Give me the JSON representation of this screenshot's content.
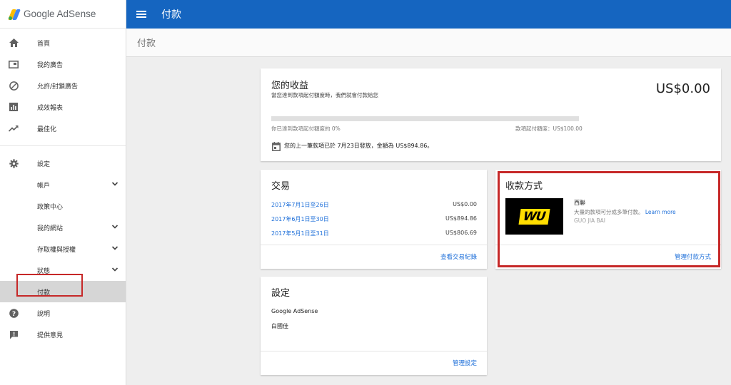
{
  "app": {
    "logo_text": "Google AdSense",
    "page_title": "付款",
    "breadcrumb": "付款"
  },
  "colors": {
    "header_blue": "#1565c0",
    "link_blue": "#1e6fd9",
    "highlight_red": "#c62828",
    "wu_yellow": "#ffdd00"
  },
  "sidebar": {
    "items": [
      {
        "label": "首頁",
        "icon": "home-icon"
      },
      {
        "label": "我的廣告",
        "icon": "ad-unit-icon"
      },
      {
        "label": "允許/封鎖廣告",
        "icon": "block-icon"
      },
      {
        "label": "成效報表",
        "icon": "bar-chart-icon"
      },
      {
        "label": "最佳化",
        "icon": "trending-up-icon"
      },
      {
        "label": "設定",
        "icon": "gear-icon"
      },
      {
        "label": "帳戶",
        "icon": "chevron-down-icon"
      },
      {
        "label": "政策中心",
        "icon": ""
      },
      {
        "label": "我的網站",
        "icon": "chevron-down-icon"
      },
      {
        "label": "存取權與授權",
        "icon": "chevron-down-icon"
      },
      {
        "label": "狀態",
        "icon": "chevron-down-icon"
      },
      {
        "label": "付款",
        "icon": ""
      },
      {
        "label": "說明",
        "icon": "help-icon"
      },
      {
        "label": "提供意見",
        "icon": "feedback-icon"
      }
    ]
  },
  "earnings": {
    "title": "您的收益",
    "subtitle": "當您達到款項起付額度時，我們就會付款給您",
    "amount": "US$0.00",
    "progress_fraction": 0.0,
    "progress_left": "你已達到款項起付額度的 0%",
    "progress_right": "款項起付額度：US$100.00",
    "last_payment": "您的上一筆款項已於 7月23日發放，金額為 US$894.86。"
  },
  "transactions": {
    "title": "交易",
    "rows": [
      {
        "date": "2017年7月1日至26日",
        "amount": "US$0.00"
      },
      {
        "date": "2017年6月1日至30日",
        "amount": "US$894.86"
      },
      {
        "date": "2017年5月1日至31日",
        "amount": "US$806.69"
      }
    ],
    "footer_link": "查看交易紀錄"
  },
  "payment_method": {
    "title": "收款方式",
    "logo_text": "WU",
    "name": "西聯",
    "desc": "大量的款項可分成多筆付款。",
    "learn_more": "Learn more",
    "payee": "GUO JIA BAI",
    "footer_link": "管理付款方式"
  },
  "settings": {
    "title": "設定",
    "product": "Google AdSense",
    "owner": "白國佳",
    "footer_link": "管理設定"
  }
}
